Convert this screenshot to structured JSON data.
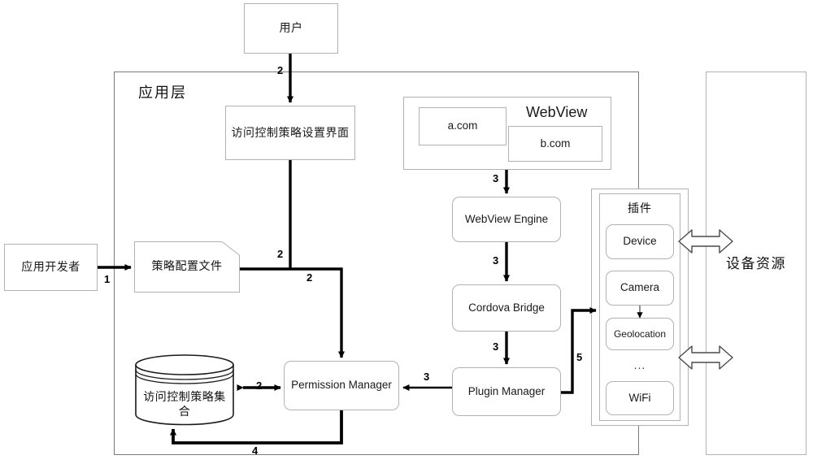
{
  "diagram": {
    "title_app_layer": "应用层",
    "nodes": {
      "user": "用户",
      "policy_ui": "访问控制策略设置界面",
      "webview_title": "WebView",
      "a_com": "a.com",
      "b_com": "b.com",
      "webview_engine": "WebView Engine",
      "cordova_bridge": "Cordova Bridge",
      "plugin_manager": "Plugin Manager",
      "permission_manager": "Permission Manager",
      "app_developer": "应用开发者",
      "policy_config_file": "策略配置文件",
      "policy_store_line1": "访问控制策略集",
      "policy_store_line2": "合",
      "plugins_title": "插件",
      "plugin_device": "Device",
      "plugin_camera": "Camera",
      "plugin_geolocation": "Geolocation",
      "plugin_ellipsis": "...",
      "plugin_wifi": "WiFi",
      "device_resource": "设备资源"
    },
    "edge_labels": {
      "dev_to_file": "1",
      "user_to_ui": "2",
      "ui_to_pm": "2",
      "file_to_pm": "2",
      "store_pm": "2",
      "engine_to_bridge": "3",
      "bridge_to_pluginmgr": "3",
      "webview_to_engine": "3",
      "pluginmgr_to_permmgr": "3",
      "pm_to_store": "4",
      "pluginmgr_to_plugins": "5"
    },
    "colors": {
      "node_border": "#b2b2b2",
      "layer_border": "#7a7a7a",
      "wire": "#000000",
      "text": "#1a1a1a",
      "background": "#ffffff"
    }
  }
}
